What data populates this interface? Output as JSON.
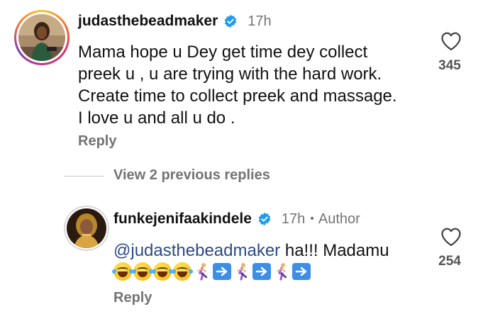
{
  "comment": {
    "username": "judasthebeadmaker",
    "time": "17h",
    "lines": [
      "Mama hope u Dey get time dey collect",
      "preek u , u are trying with the hard work.",
      "Create time to collect preek and massage.",
      "I love u and all u do ."
    ],
    "reply_label": "Reply",
    "like_count": "345",
    "icons": {
      "avatar": "user-avatar-photo",
      "verified": "verified-badge-icon",
      "like": "heart-outline-icon"
    }
  },
  "view_replies_label": "View 2 previous replies",
  "reply": {
    "username": "funkejenifaakindele",
    "time": "17h",
    "separator": "•",
    "author_label": "Author",
    "mention": "@judasthebeadmaker",
    "text": " ha!!! Madamu",
    "emojis": [
      "😂",
      "😂",
      "😂",
      "😂",
      "🏃‍♀️",
      "➡️",
      "🏃‍♀️",
      "➡️",
      "🏃‍♀️",
      "➡️"
    ],
    "reply_label": "Reply",
    "like_count": "254",
    "icons": {
      "avatar": "user-avatar-photo",
      "verified": "verified-badge-icon",
      "like": "heart-outline-icon"
    }
  },
  "colors": {
    "verified_blue": "#1d9bf0",
    "mention_blue": "#2b4a86",
    "secondary_text": "#737373"
  }
}
